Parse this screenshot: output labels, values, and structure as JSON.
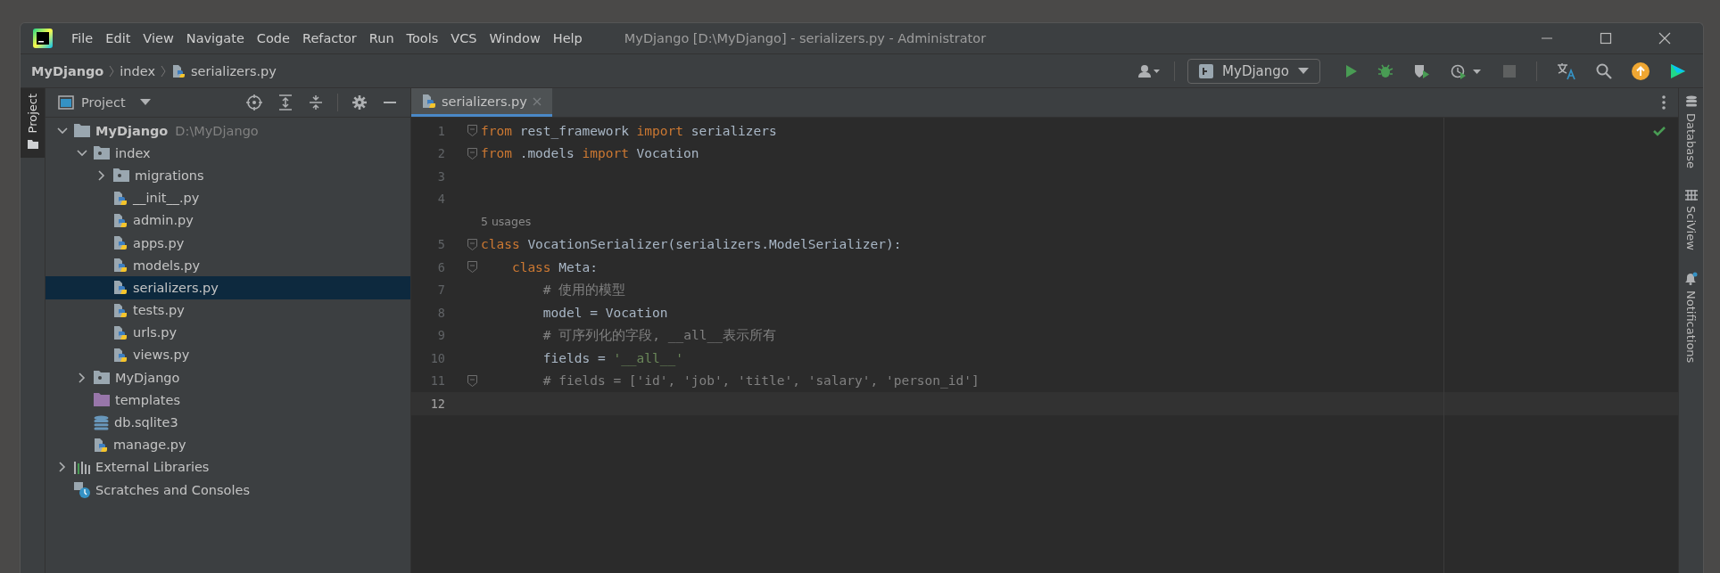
{
  "window": {
    "title": "MyDjango [D:\\MyDjango] - serializers.py - Administrator"
  },
  "menu": [
    "File",
    "Edit",
    "View",
    "Navigate",
    "Code",
    "Refactor",
    "Run",
    "Tools",
    "VCS",
    "Window",
    "Help"
  ],
  "breadcrumbs": [
    {
      "label": "MyDjango",
      "kind": "project"
    },
    {
      "label": "index",
      "kind": "folder"
    },
    {
      "label": "serializers.py",
      "kind": "python"
    }
  ],
  "run_config": {
    "label": "MyDjango"
  },
  "left_stripe": [
    {
      "label": "Project",
      "selected": true
    }
  ],
  "right_stripe": [
    {
      "label": "Database",
      "kind": "database"
    },
    {
      "label": "SciView",
      "kind": "sciview"
    },
    {
      "label": "Notifications",
      "kind": "notifications"
    }
  ],
  "project_panel": {
    "title": "Project",
    "tree": [
      {
        "label": "MyDjango",
        "path": "D:\\MyDjango",
        "kind": "root",
        "expanded": true,
        "selected": false,
        "children": [
          {
            "label": "index",
            "kind": "module",
            "expanded": true,
            "selected": false,
            "children": [
              {
                "label": "migrations",
                "kind": "module",
                "expanded": false,
                "selected": false
              },
              {
                "label": "__init__.py",
                "kind": "python",
                "selected": false
              },
              {
                "label": "admin.py",
                "kind": "python",
                "selected": false
              },
              {
                "label": "apps.py",
                "kind": "python",
                "selected": false
              },
              {
                "label": "models.py",
                "kind": "python",
                "selected": false
              },
              {
                "label": "serializers.py",
                "kind": "python",
                "selected": true
              },
              {
                "label": "tests.py",
                "kind": "python",
                "selected": false
              },
              {
                "label": "urls.py",
                "kind": "python",
                "selected": false
              },
              {
                "label": "views.py",
                "kind": "python",
                "selected": false
              }
            ]
          },
          {
            "label": "MyDjango",
            "kind": "module",
            "expanded": false,
            "selected": false
          },
          {
            "label": "templates",
            "kind": "templates",
            "selected": false
          },
          {
            "label": "db.sqlite3",
            "kind": "db",
            "selected": false
          },
          {
            "label": "manage.py",
            "kind": "python",
            "selected": false
          }
        ]
      },
      {
        "label": "External Libraries",
        "kind": "library",
        "expanded": false,
        "selected": false
      },
      {
        "label": "Scratches and Consoles",
        "kind": "scratches",
        "selected": false
      }
    ]
  },
  "tabs": [
    {
      "label": "serializers.py",
      "selected": true
    }
  ],
  "editor": {
    "lines": [
      {
        "kind": "code",
        "number": "1",
        "fold": true,
        "current": false,
        "tokens": [
          {
            "kind": "keyword",
            "text": "from"
          },
          {
            "kind": "plain",
            "text": " rest_framework "
          },
          {
            "kind": "keyword",
            "text": "import"
          },
          {
            "kind": "plain",
            "text": " serializers"
          }
        ]
      },
      {
        "kind": "code",
        "number": "2",
        "fold": true,
        "current": false,
        "tokens": [
          {
            "kind": "keyword",
            "text": "from"
          },
          {
            "kind": "plain",
            "text": " .models "
          },
          {
            "kind": "keyword",
            "text": "import"
          },
          {
            "kind": "plain",
            "text": " Vocation"
          }
        ]
      },
      {
        "kind": "code",
        "number": "3",
        "fold": false,
        "current": false
      },
      {
        "kind": "code",
        "number": "4",
        "fold": false,
        "current": false
      },
      {
        "kind": "hint",
        "text": "5 usages"
      },
      {
        "kind": "code",
        "number": "5",
        "fold": true,
        "current": false,
        "tokens": [
          {
            "kind": "keyword",
            "text": "class"
          },
          {
            "kind": "plain",
            "text": " VocationSerializer(serializers.ModelSerializer):"
          }
        ]
      },
      {
        "kind": "code",
        "number": "6",
        "fold": true,
        "current": false,
        "tokens": [
          {
            "kind": "keyword",
            "text": "    class"
          },
          {
            "kind": "plain",
            "text": " Meta:"
          }
        ]
      },
      {
        "kind": "code",
        "number": "7",
        "fold": false,
        "current": false,
        "tokens": [
          {
            "kind": "comment",
            "text": "        # 使用的模型"
          }
        ]
      },
      {
        "kind": "code",
        "number": "8",
        "fold": false,
        "current": false,
        "tokens": [
          {
            "kind": "plain",
            "text": "        model = Vocation"
          }
        ]
      },
      {
        "kind": "code",
        "number": "9",
        "fold": false,
        "current": false,
        "tokens": [
          {
            "kind": "comment",
            "text": "        # 可序列化的字段, __all__表示所有"
          }
        ]
      },
      {
        "kind": "code",
        "number": "10",
        "fold": false,
        "current": false,
        "tokens": [
          {
            "kind": "plain",
            "text": "        fields = "
          },
          {
            "kind": "string",
            "text": "'__all__'"
          }
        ]
      },
      {
        "kind": "code",
        "number": "11",
        "fold": true,
        "current": false,
        "tokens": [
          {
            "kind": "comment",
            "text": "        # fields = ['id', 'job', 'title', 'salary', 'person_id']"
          }
        ]
      },
      {
        "kind": "code",
        "number": "12",
        "fold": false,
        "current": true
      }
    ]
  }
}
